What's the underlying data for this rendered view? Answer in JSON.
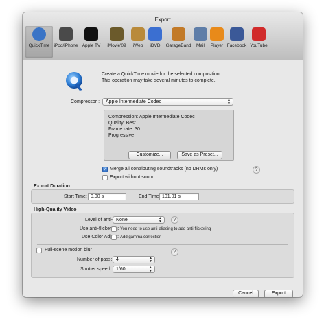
{
  "window": {
    "title": "Export"
  },
  "toolbar": {
    "items": [
      {
        "label": "QuickTime",
        "icon": "quicktime-icon",
        "color": "#3a74c6"
      },
      {
        "label": "iPod/iPhone",
        "icon": "ipod-iphone-icon",
        "color": "#4a4a4a"
      },
      {
        "label": "Apple TV",
        "icon": "apple-tv-icon",
        "color": "#111111"
      },
      {
        "label": "iMovie'09",
        "icon": "imovie-icon",
        "color": "#6b5a2b"
      },
      {
        "label": "iWeb",
        "icon": "iweb-icon",
        "color": "#b98a3a"
      },
      {
        "label": "iDVD",
        "icon": "idvd-icon",
        "color": "#3b6fd1"
      },
      {
        "label": "GarageBand",
        "icon": "garageband-icon",
        "color": "#c27a28"
      },
      {
        "label": "Mail",
        "icon": "mail-icon",
        "color": "#5f7ea8"
      },
      {
        "label": "Player",
        "icon": "player-icon",
        "color": "#e88a1a"
      },
      {
        "label": "Facebook",
        "icon": "facebook-icon",
        "color": "#3b5998"
      },
      {
        "label": "YouTube",
        "icon": "youtube-icon",
        "color": "#d12b2b"
      }
    ]
  },
  "intro": {
    "line1": "Create a QuickTime movie for the selected composition.",
    "line2": "This operation may take several minutes to complete."
  },
  "compressor": {
    "label": "Compressor :",
    "value": "Apple Intermediate Codec",
    "info": {
      "compression": "Compression: Apple Intermediate Codec",
      "quality": "Quality: Best",
      "frame_rate": "Frame rate: 30",
      "scan": "Progressive"
    },
    "customize_label": "Customize...",
    "save_preset_label": "Save as Preset..."
  },
  "audio": {
    "merge_label": "Merge all contributing soundtracks (no DRMs only)",
    "merge_checked": true,
    "without_sound_label": "Export without sound",
    "without_sound_checked": false
  },
  "export_duration": {
    "title": "Export Duration",
    "start_label": "Start Time:",
    "start_value": "0.00 s",
    "end_label": "End Time:",
    "end_value": "101.01 s"
  },
  "hq_video": {
    "title": "High-Quality Video",
    "aa_label": "Level of anti-aliasing:",
    "aa_value": "None",
    "flicker_label": "Use anti-flickering:",
    "flicker_note": "You need to use anti-aliasing to add anti-flickering",
    "color_label": "Use Color Adjust:",
    "color_note": "Add gamma correction",
    "motion_blur_label": "Full-scene motion blur",
    "pass_label": "Number of pass:",
    "pass_value": "4",
    "shutter_label": "Shutter speed:",
    "shutter_value": "1/60"
  },
  "footer": {
    "cancel_label": "Cancel",
    "export_label": "Export"
  },
  "glyphs": {
    "help": "?",
    "check": "✓",
    "arrows_up": "▲",
    "arrows_down": "▼"
  }
}
